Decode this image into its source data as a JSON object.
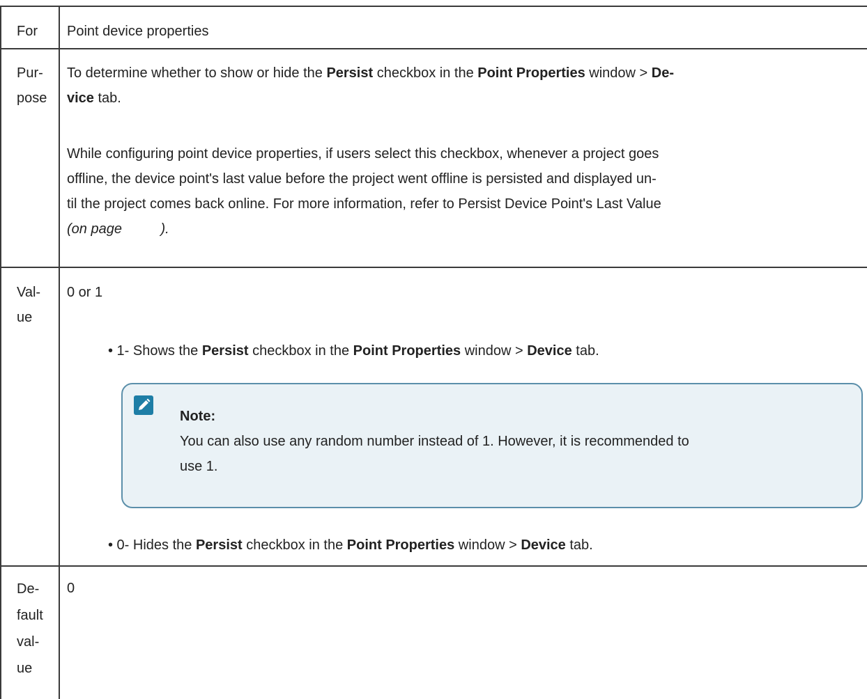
{
  "rows": {
    "for": {
      "label": "For",
      "value": "Point device properties"
    },
    "purpose": {
      "label_lines": [
        "Pur-",
        "pose"
      ],
      "p1": {
        "t1": "To determine whether to show or hide the ",
        "b1": "Persist",
        "t2": " checkbox in the ",
        "b2": "Point Properties",
        "t3": " window > ",
        "b3a": "De-",
        "b3b": "vice",
        "t4": " tab."
      },
      "p2_lines": [
        "While configuring point device properties, if users select this checkbox, whenever a project goes",
        "offline, the device point's last value before the project went offline is persisted and displayed un-",
        "til the project comes back online. For more information, refer to Persist Device Point's Last Value"
      ],
      "p2_ref": "(on page          )."
    },
    "value": {
      "label_lines": [
        "Val-",
        "ue"
      ],
      "intro": "0 or 1",
      "bullet1": {
        "t1": "• 1- Shows the ",
        "b1": "Persist",
        "t2": " checkbox in the ",
        "b2": "Point Properties",
        "t3": " window > ",
        "b3": "Device",
        "t4": " tab."
      },
      "note": {
        "icon": "pencil-icon",
        "title": "Note:",
        "body_lines": [
          "You can also use any random number instead of 1. However, it is recommended to",
          "use 1."
        ]
      },
      "bullet2": {
        "t1": "• 0- Hides the ",
        "b1": "Persist",
        "t2": " checkbox in the ",
        "b2": "Point Properties",
        "t3": " window > ",
        "b3": "Device",
        "t4": " tab."
      }
    },
    "default": {
      "label_lines": [
        "De-",
        "fault",
        "val-",
        "ue"
      ],
      "value": "0"
    }
  },
  "colors": {
    "border": "#3a3a3a",
    "note_bg": "#eaf2f6",
    "note_border": "#5b8faa",
    "note_icon": "#1e7ea6"
  }
}
